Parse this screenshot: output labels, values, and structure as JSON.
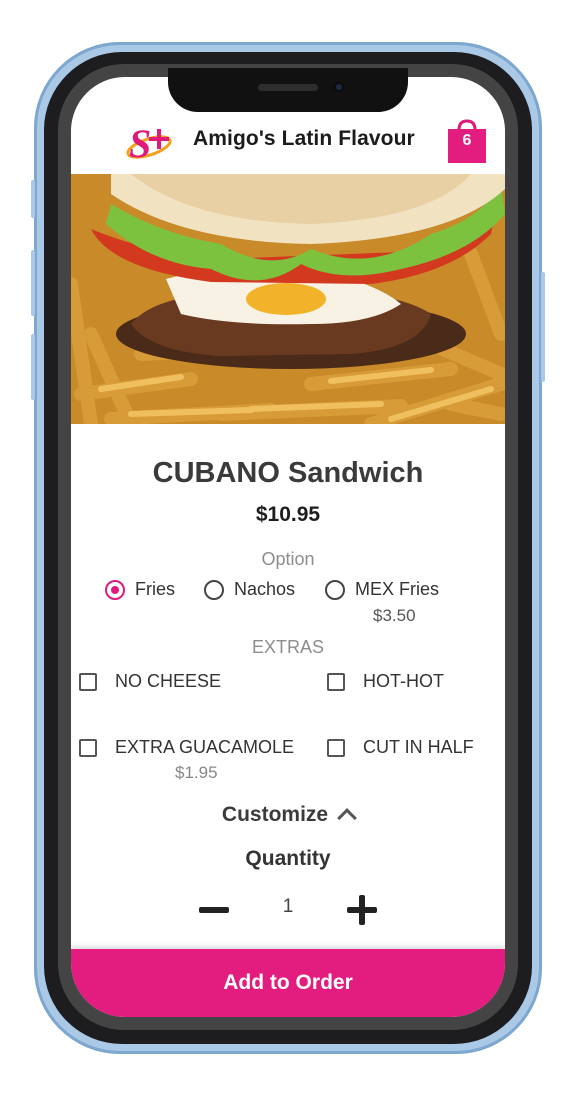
{
  "app": {
    "brand_name": "Amigo's Latin Flavour",
    "cart_count": "6",
    "accent_color": "#e31c7f"
  },
  "icons": {
    "logo": "amigos-logo-icon",
    "cart": "shopping-bag-icon",
    "collapse": "chevron-up-icon",
    "decrease": "minus-icon",
    "increase": "plus-icon"
  },
  "product": {
    "image": "burger-with-fries-photo",
    "name": "CUBANO Sandwich",
    "price": "$10.95"
  },
  "options": {
    "label": "Option",
    "items": [
      {
        "label": "Fries",
        "selected": true
      },
      {
        "label": "Nachos",
        "selected": false
      },
      {
        "label": "MEX Fries",
        "selected": false,
        "price": "$3.50"
      }
    ]
  },
  "extras": {
    "label": "EXTRAS",
    "items": [
      {
        "label": "NO CHEESE",
        "checked": false
      },
      {
        "label": "HOT-HOT",
        "checked": false
      },
      {
        "label": "EXTRA GUACAMOLE",
        "checked": false,
        "price": "$1.95"
      },
      {
        "label": "CUT IN HALF",
        "checked": false
      }
    ]
  },
  "customize": {
    "label": "Customize"
  },
  "quantity": {
    "label": "Quantity",
    "value": "1"
  },
  "actions": {
    "add_to_order": "Add to Order"
  }
}
